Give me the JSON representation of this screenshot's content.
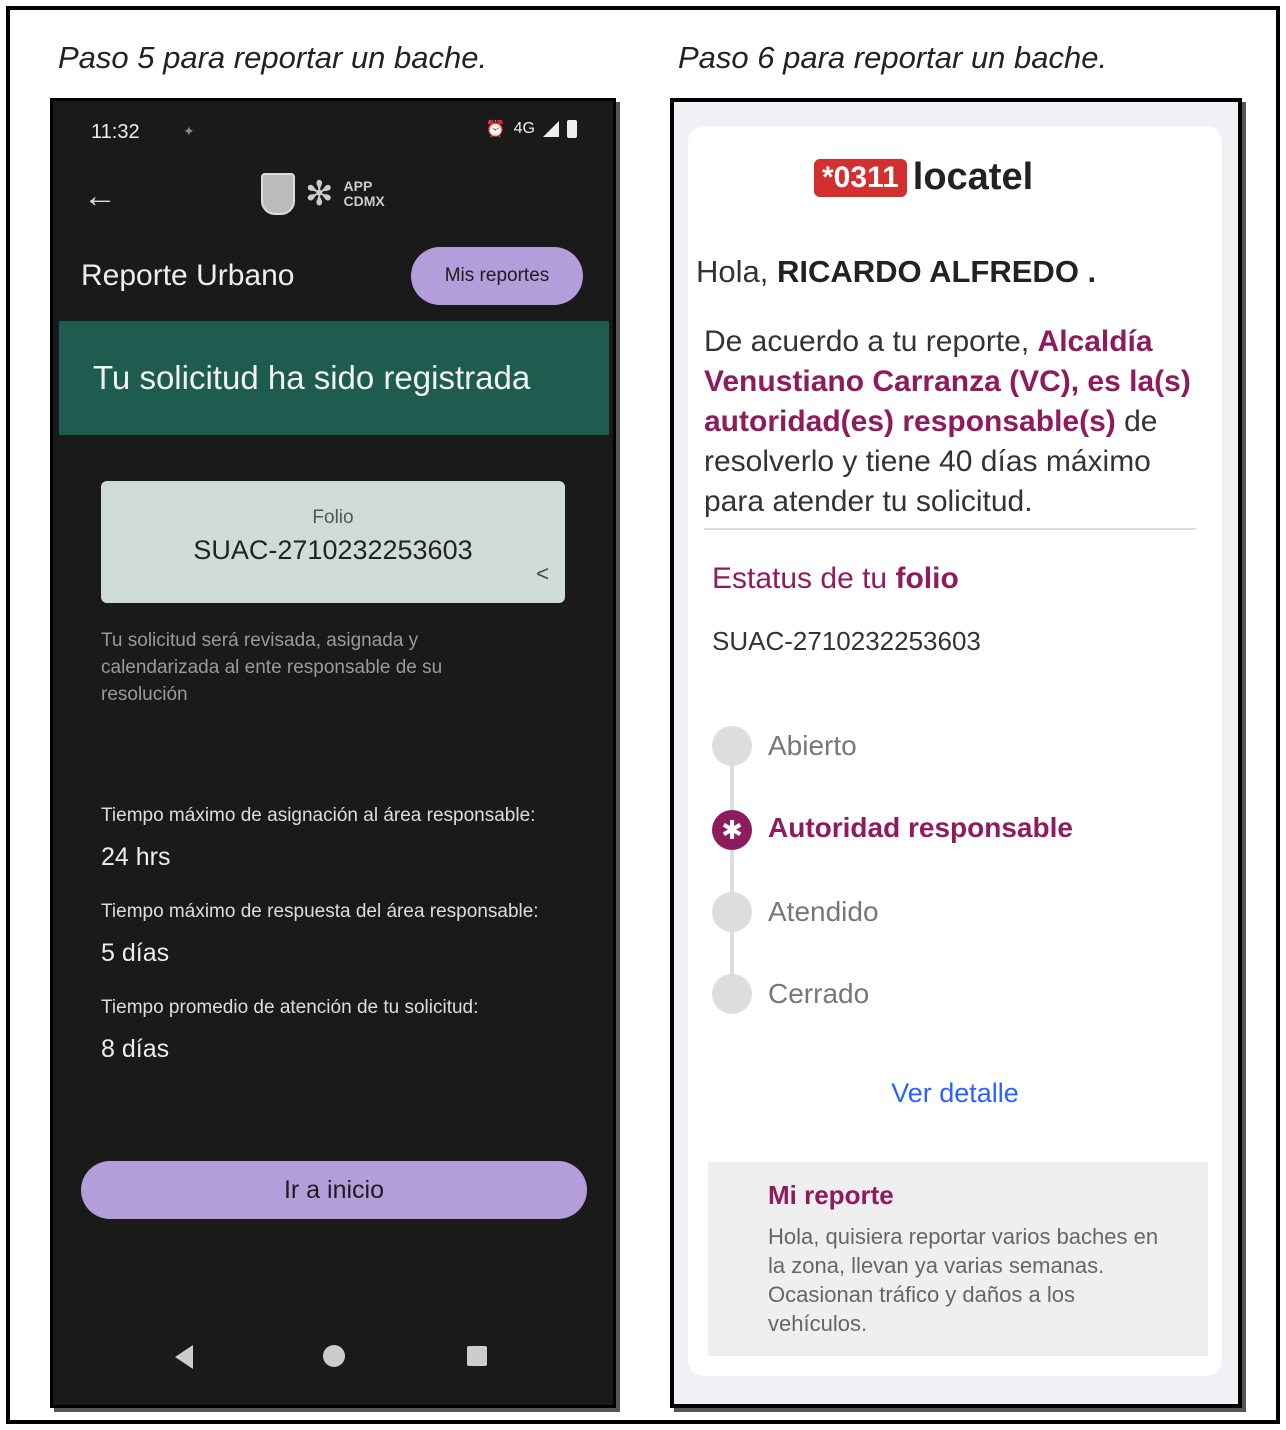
{
  "captions": {
    "left": "Paso 5 para reportar un bache.",
    "right": "Paso 6 para reportar un bache."
  },
  "app": {
    "status_time": "11:32",
    "status_network": "4G",
    "logo_text_line1": "APP",
    "logo_text_line2": "CDMX",
    "page_title": "Reporte Urbano",
    "mis_reportes_label": "Mis reportes",
    "banner_text": "Tu solicitud ha sido registrada",
    "folio_label": "Folio",
    "folio_value": "SUAC-2710232253603",
    "note": "Tu solicitud será revisada, asignada y calendarizada al ente responsable de su resolución",
    "metrics": [
      {
        "label": "Tiempo máximo de asignación al área responsable:",
        "value": "24 hrs"
      },
      {
        "label": "Tiempo máximo de respuesta del área responsable:",
        "value": "5 días"
      },
      {
        "label": "Tiempo promedio de atención de tu solicitud:",
        "value": "8 días"
      }
    ],
    "home_button_label": "Ir a inicio"
  },
  "email": {
    "logo_badge": "*0311",
    "logo_text": "locatel",
    "greeting_prefix": "Hola, ",
    "greeting_name": "RICARDO ALFREDO .",
    "para_prefix": "De acuerdo a tu reporte, ",
    "para_highlight": "Alcaldía Venustiano Carranza (VC), es la(s) autoridad(es) responsable(s)",
    "para_suffix": " de resolverlo y tiene 40 días máximo para atender tu solicitud.",
    "status_title_prefix": "Estatus de tu ",
    "status_title_bold": "folio",
    "status_folio": "SUAC-2710232253603",
    "timeline": [
      {
        "label": "Abierto",
        "active": false
      },
      {
        "label": "Autoridad responsable",
        "active": true
      },
      {
        "label": "Atendido",
        "active": false
      },
      {
        "label": "Cerrado",
        "active": false
      }
    ],
    "ver_detalle": "Ver detalle",
    "mi_reporte_title": "Mi reporte",
    "mi_reporte_body": "Hola, quisiera reportar varios baches en la zona, llevan ya varias semanas. Ocasionan tráfico y daños a los vehículos."
  },
  "colors": {
    "banner_green": "#1d5c4e",
    "lavender_button": "#b39ddb",
    "accent_magenta": "#8e1b5e",
    "link_blue": "#2962ff",
    "locatel_red": "#d32f2f"
  }
}
